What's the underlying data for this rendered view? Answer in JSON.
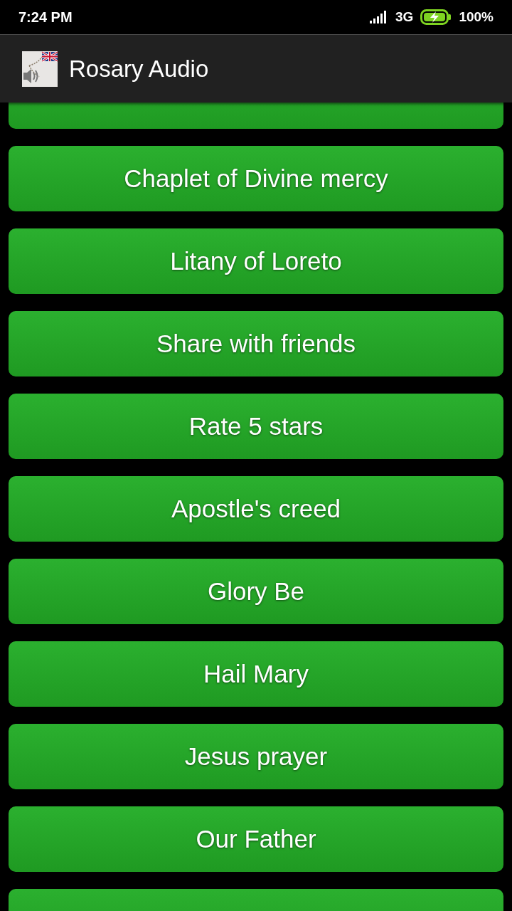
{
  "status_bar": {
    "time": "7:24 PM",
    "network": "3G",
    "battery": "100%"
  },
  "app_bar": {
    "title": "Rosary Audio"
  },
  "menu_items": [
    {
      "kind": "blank"
    },
    {
      "kind": "button",
      "label": "Chaplet of Divine mercy"
    },
    {
      "kind": "button",
      "label": "Litany of Loreto"
    },
    {
      "kind": "button",
      "label": "Share with friends"
    },
    {
      "kind": "button",
      "label": "Rate 5 stars"
    },
    {
      "kind": "button",
      "label": "Apostle's creed"
    },
    {
      "kind": "button",
      "label": "Glory Be"
    },
    {
      "kind": "button",
      "label": "Hail Mary"
    },
    {
      "kind": "button",
      "label": "Jesus prayer"
    },
    {
      "kind": "button",
      "label": "Our Father"
    },
    {
      "kind": "blank"
    }
  ]
}
